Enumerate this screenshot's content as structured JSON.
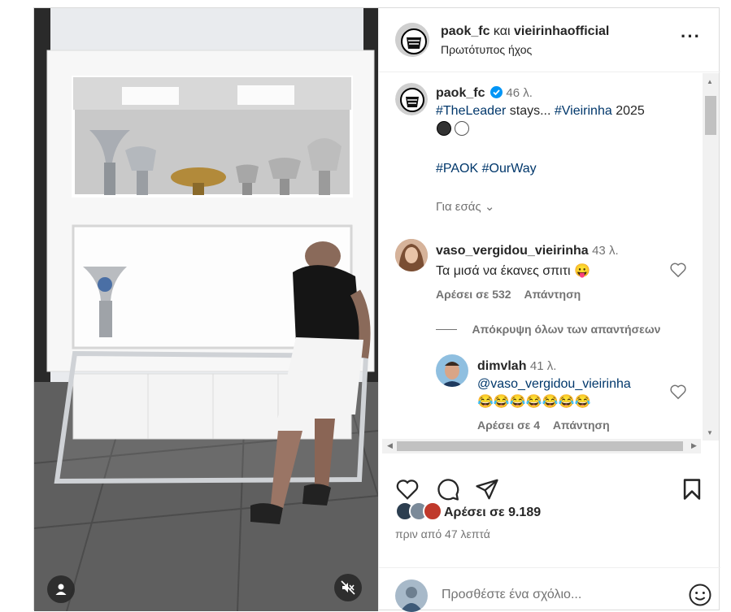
{
  "header": {
    "user1": "paok_fc",
    "conj": "και",
    "user2": "vieirinhaofficial",
    "audio": "Πρωτότυπος ήχος",
    "more_icon": "ellipsis-icon"
  },
  "caption": {
    "user": "paok_fc",
    "verified": true,
    "time": "46 λ.",
    "tag1": "#TheLeader",
    "text1": " stays... ",
    "tag2": "#Vieirinha",
    "text2": " 2025",
    "emojis": "⚫⚪",
    "tags_line": [
      "#PAOK",
      "#OurWay"
    ],
    "for_you": "Για εσάς"
  },
  "comments": [
    {
      "user": "vaso_vergidou_vieirinha",
      "time": "43 λ.",
      "text": "Τα μισά να έκανες σπιτι",
      "emoji": "😛",
      "likes": "Αρέσει σε 532",
      "reply": "Απάντηση"
    }
  ],
  "hide_replies": "Απόκρυψη όλων των απαντήσεων",
  "reply": {
    "user": "dimvlah",
    "time": "41 λ.",
    "mention": "@vaso_vergidou_vieirinha",
    "emojis": "😂😂😂😂😂😂😂",
    "likes": "Αρέσει σε 4",
    "reply": "Απάντηση"
  },
  "actions": {
    "like_icon": "heart-icon",
    "comment_icon": "comment-icon",
    "share_icon": "send-icon",
    "save_icon": "bookmark-icon"
  },
  "likes_text": "Αρέσει σε 9.189",
  "posted": "πριν από 47 λεπτά",
  "add_comment_placeholder": "Προσθέστε ένα σχόλιο...",
  "colors": {
    "link": "#00376b",
    "verified": "#0095f6",
    "annotation": "#e0262b",
    "muted": "#737373"
  }
}
